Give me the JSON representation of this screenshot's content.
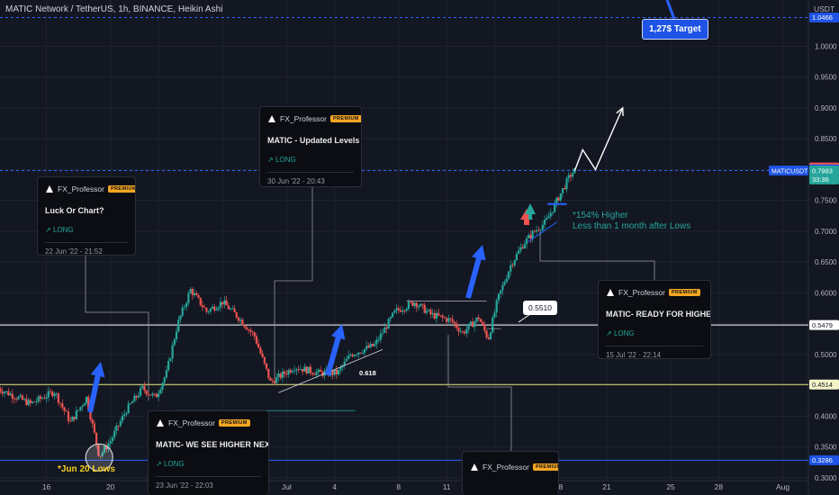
{
  "chart_title": "MATIC Network / TetherUS, 1h, BINANCE, Heikin Ashi",
  "currency": "USDT",
  "colors": {
    "bg": "#131722",
    "up": "#26a69a",
    "down": "#ef5350",
    "arrow": "#2962ff",
    "grid": "#1f2430"
  },
  "chart_data": {
    "type": "candlestick",
    "title": "MATIC Network / TetherUS, 1h, BINANCE, Heikin Ashi",
    "y_ticks": [
      "1.0000",
      "0.9500",
      "0.9000",
      "0.8500",
      "0.8000",
      "0.7500",
      "0.7000",
      "0.6500",
      "0.6000",
      "0.5500",
      "0.5000",
      "0.4500",
      "0.4000",
      "0.3500",
      "0.3000"
    ],
    "y_tick_values": [
      1.0,
      0.95,
      0.9,
      0.85,
      0.8,
      0.75,
      0.7,
      0.65,
      0.6,
      0.55,
      0.5,
      0.45,
      0.4,
      0.35,
      0.3
    ],
    "ylim": [
      0.2955,
      1.075
    ],
    "x_tick_labels": [
      "16",
      "20",
      "23",
      "27",
      "Jul",
      "4",
      "8",
      "11",
      "14",
      "18",
      "21",
      "25",
      "28",
      "Aug"
    ],
    "x_tick_days": [
      0,
      4,
      7,
      11,
      15,
      18,
      22,
      25,
      28,
      32,
      35,
      39,
      42,
      46
    ],
    "xlim_days": [
      -2.9,
      47.6
    ],
    "price_levels": [
      {
        "value": 1.0466,
        "label": "1.0466",
        "style": "dashed",
        "color": "#2962ff"
      },
      {
        "value": 0.7983,
        "label": "0.7983",
        "style": "dashed",
        "color": "#2962ff"
      },
      {
        "value": 0.5479,
        "label": "0.5479",
        "style": "solid",
        "color": "#ffffff"
      },
      {
        "value": 0.4514,
        "label": "0.4514",
        "style": "solid",
        "color": "#e8e57a"
      },
      {
        "value": 0.3286,
        "label": "0.3286",
        "style": "solid",
        "color": "#2962ff"
      }
    ],
    "axis_tags": [
      {
        "label": "0.8033",
        "value": 0.8033,
        "bg": "#ef5350",
        "fg": "#ffffff"
      },
      {
        "label": "0.8002",
        "value": 0.8002,
        "bg": "#1e53e5",
        "fg": "#ffffff"
      },
      {
        "label": "0.7983",
        "value": 0.7983,
        "bg": "#26a69a",
        "fg": "#ffffff"
      },
      {
        "label": "33:36",
        "value": 0.784,
        "bg": "#26a69a",
        "fg": "#ffffff"
      },
      {
        "label": "1.0466",
        "value": 1.0466,
        "bg": "#1e53e5",
        "fg": "#ffffff"
      },
      {
        "label": "0.5479",
        "value": 0.5479,
        "bg": "#ffffff",
        "fg": "#131722"
      },
      {
        "label": "0.4514",
        "value": 0.4514,
        "bg": "#f4f3c8",
        "fg": "#131722"
      },
      {
        "label": "0.3286",
        "value": 0.3286,
        "bg": "#1e53e5",
        "fg": "#ffffff"
      }
    ],
    "symbol_tag": "MATICUSDT",
    "anchors": [
      {
        "d": -3,
        "p": 0.445
      },
      {
        "d": -1,
        "p": 0.42
      },
      {
        "d": 0.5,
        "p": 0.44
      },
      {
        "d": 1.5,
        "p": 0.39
      },
      {
        "d": 2.5,
        "p": 0.43
      },
      {
        "d": 3.3,
        "p": 0.335
      },
      {
        "d": 4,
        "p": 0.36
      },
      {
        "d": 5,
        "p": 0.41
      },
      {
        "d": 6,
        "p": 0.445
      },
      {
        "d": 6.8,
        "p": 0.43
      },
      {
        "d": 7.5,
        "p": 0.47
      },
      {
        "d": 8.2,
        "p": 0.55
      },
      {
        "d": 9,
        "p": 0.605
      },
      {
        "d": 10,
        "p": 0.57
      },
      {
        "d": 11,
        "p": 0.585
      },
      {
        "d": 12,
        "p": 0.56
      },
      {
        "d": 13,
        "p": 0.53
      },
      {
        "d": 14,
        "p": 0.455
      },
      {
        "d": 15.5,
        "p": 0.48
      },
      {
        "d": 17,
        "p": 0.47
      },
      {
        "d": 18.2,
        "p": 0.47
      },
      {
        "d": 19,
        "p": 0.5
      },
      {
        "d": 20.5,
        "p": 0.515
      },
      {
        "d": 21.8,
        "p": 0.57
      },
      {
        "d": 23,
        "p": 0.585
      },
      {
        "d": 24,
        "p": 0.565
      },
      {
        "d": 25.3,
        "p": 0.555
      },
      {
        "d": 26,
        "p": 0.535
      },
      {
        "d": 27,
        "p": 0.56
      },
      {
        "d": 27.6,
        "p": 0.525
      },
      {
        "d": 28.2,
        "p": 0.59
      },
      {
        "d": 29,
        "p": 0.645
      },
      {
        "d": 29.8,
        "p": 0.68
      },
      {
        "d": 30.5,
        "p": 0.7
      },
      {
        "d": 31.2,
        "p": 0.715
      },
      {
        "d": 32,
        "p": 0.755
      },
      {
        "d": 32.7,
        "p": 0.79
      },
      {
        "d": 33,
        "p": 0.798
      }
    ],
    "projection": [
      {
        "d": 33,
        "p": 0.798
      },
      {
        "d": 33.5,
        "p": 0.832
      },
      {
        "d": 34.3,
        "p": 0.8
      },
      {
        "d": 36,
        "p": 0.9
      }
    ]
  },
  "cards": [
    {
      "author": "FX_Professor",
      "badge": "PREMIUM",
      "title": "Luck Or  Chart?",
      "direction": "LONG",
      "date": "22 Jun '22 - 21:52"
    },
    {
      "author": "FX_Professor",
      "badge": "PREMIUM",
      "title": "MATIC - Updated Levels",
      "direction": "LONG",
      "date": "30 Jun '22 - 20:43"
    },
    {
      "author": "FX_Professor",
      "badge": "PREMIUM",
      "title": "MATIC- READY FOR HIGHER",
      "direction": "LONG",
      "date": "15 Jul '22 - 22:14"
    },
    {
      "author": "FX_Professor",
      "badge": "PREMIUM",
      "title": "MATIC- WE SEE HIGHER NEXT",
      "direction": "LONG",
      "date": "23 Jun '22 - 22:03"
    },
    {
      "author": "FX_Professor",
      "badge": "PREMIUM",
      "title": "",
      "direction": "",
      "date": ""
    }
  ],
  "annotations": {
    "target": "1,27$ Target",
    "price_label": "0.5510",
    "note_line1": "*154% Higher",
    "note_line2": "Less than 1 month after Lows",
    "lows": "*Jun 20 Lows",
    "fib": "0.618"
  }
}
